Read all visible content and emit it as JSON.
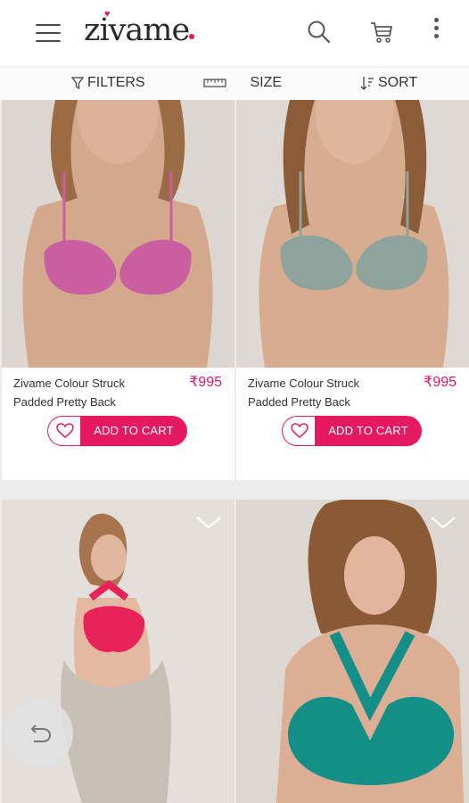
{
  "header": {
    "logo_text": "zivame",
    "icons": [
      "hamburger-menu-icon",
      "search-icon",
      "cart-icon",
      "more-vertical-icon"
    ]
  },
  "filterbar": {
    "filters_label": "FILTERS",
    "size_label": "SIZE",
    "sort_label": "SORT"
  },
  "products": [
    {
      "name_line1": "Zivame Colour Struck",
      "name_line2": "Padded Pretty Back",
      "price": "₹995",
      "add_label": "ADD TO CART",
      "color": "#c95ea0"
    },
    {
      "name_line1": "Zivame Colour Struck",
      "name_line2": "Padded Pretty Back",
      "price": "₹995",
      "add_label": "ADD TO CART",
      "color": "#8fa39d"
    },
    {
      "color": "#e8235a"
    },
    {
      "color": "#138f88"
    }
  ],
  "colors": {
    "accent": "#e5195f",
    "background": "#ececec"
  }
}
